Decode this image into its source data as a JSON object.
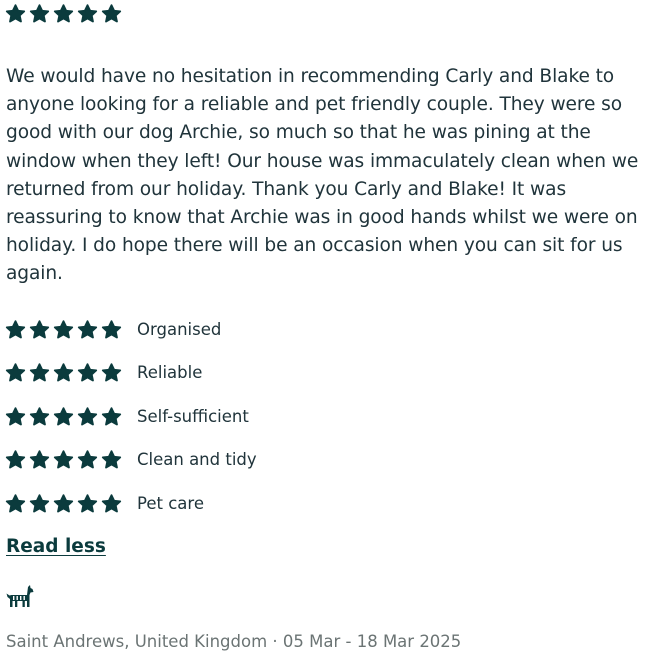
{
  "review": {
    "overall_rating": 5,
    "text": "We would have no hesitation in recommending Carly and Blake to anyone looking for a reliable and pet friendly couple. They were so good with our dog Archie, so much so that he was pining at the window when they left! Our house was immaculately clean when we returned from our holiday. Thank you Carly and Blake! It was reassuring to know that Archie was in good hands whilst we were on holiday. I do hope there will be an occasion when you can sit for us again."
  },
  "ratings": [
    {
      "label": "Organised",
      "stars": 5
    },
    {
      "label": "Reliable",
      "stars": 5
    },
    {
      "label": "Self-sufficient",
      "stars": 5
    },
    {
      "label": "Clean and tidy",
      "stars": 5
    },
    {
      "label": "Pet care",
      "stars": 5
    }
  ],
  "toggle": {
    "read_less_label": "Read less"
  },
  "pet": {
    "icon": "dog-icon"
  },
  "footer": {
    "location_dates": "Saint Andrews, United Kingdom · 05 Mar - 18 Mar 2025"
  },
  "colors": {
    "star": "#0b3b3d",
    "text": "#20343b",
    "muted": "#6b7474"
  }
}
